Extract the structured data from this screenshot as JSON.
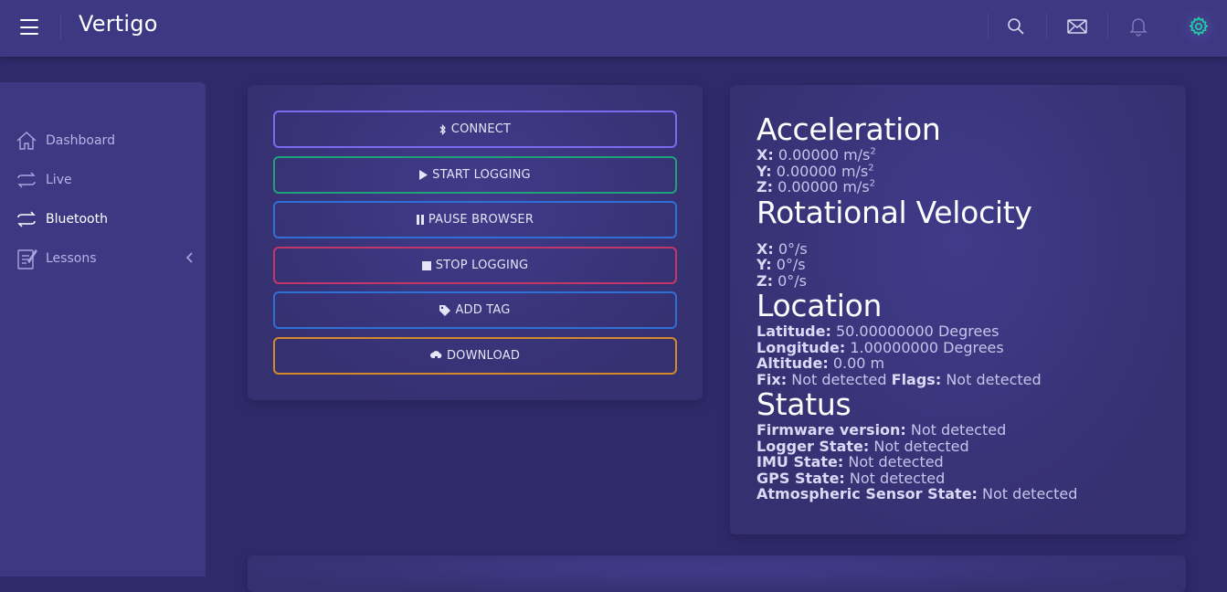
{
  "app": {
    "title": "Vertigo"
  },
  "topbar": {
    "icons": [
      "menu-icon",
      "search-icon",
      "mail-icon",
      "bell-icon",
      "gear-icon"
    ],
    "accent": "#1fd1a0"
  },
  "sidebar": {
    "items": [
      {
        "label": "Dashboard",
        "icon": "home-icon",
        "active": false
      },
      {
        "label": "Live",
        "icon": "arrows-icon",
        "active": false
      },
      {
        "label": "Bluetooth",
        "icon": "arrows-icon",
        "active": true
      },
      {
        "label": "Lessons",
        "icon": "notepad-icon",
        "active": false
      }
    ]
  },
  "controls": {
    "connect": "CONNECT",
    "start_logging": "START LOGGING",
    "pause_browser": "PAUSE BROWSER",
    "stop_logging": "STOP LOGGING",
    "add_tag": "ADD TAG",
    "download": "DOWNLOAD",
    "colors": {
      "connect": "#7a6bf0",
      "start": "#1fa27a",
      "pause": "#2f6fd6",
      "stop": "#c2376a",
      "tag": "#2f6fd6",
      "download": "#d48a2a"
    }
  },
  "acceleration": {
    "title": "Acceleration",
    "x_label": "X:",
    "x_value": "0.00000 m/s",
    "x_exp": "2",
    "y_label": "Y:",
    "y_value": "0.00000 m/s",
    "y_exp": "2",
    "z_label": "Z:",
    "z_value": "0.00000 m/s",
    "z_exp": "2"
  },
  "rotational_velocity": {
    "title": "Rotational Velocity",
    "x_label": "X:",
    "x_value": "0°/s",
    "y_label": "Y:",
    "y_value": "0°/s",
    "z_label": "Z:",
    "z_value": "0°/s"
  },
  "location": {
    "title": "Location",
    "latitude_label": "Latitude:",
    "latitude_value": "50.00000000 Degrees",
    "longitude_label": "Longitude:",
    "longitude_value": "1.00000000 Degrees",
    "altitude_label": "Altitude:",
    "altitude_value": "0.00 m",
    "fix_label": "Fix:",
    "fix_value": "Not detected",
    "flags_label": "Flags:",
    "flags_value": "Not detected"
  },
  "status": {
    "title": "Status",
    "firmware_label": "Firmware version:",
    "firmware_value": "Not detected",
    "logger_label": "Logger State:",
    "logger_value": "Not detected",
    "imu_label": "IMU State:",
    "imu_value": "Not detected",
    "gps_label": "GPS State:",
    "gps_value": "Not detected",
    "atmo_label": "Atmospheric Sensor State:",
    "atmo_value": "Not detected"
  }
}
